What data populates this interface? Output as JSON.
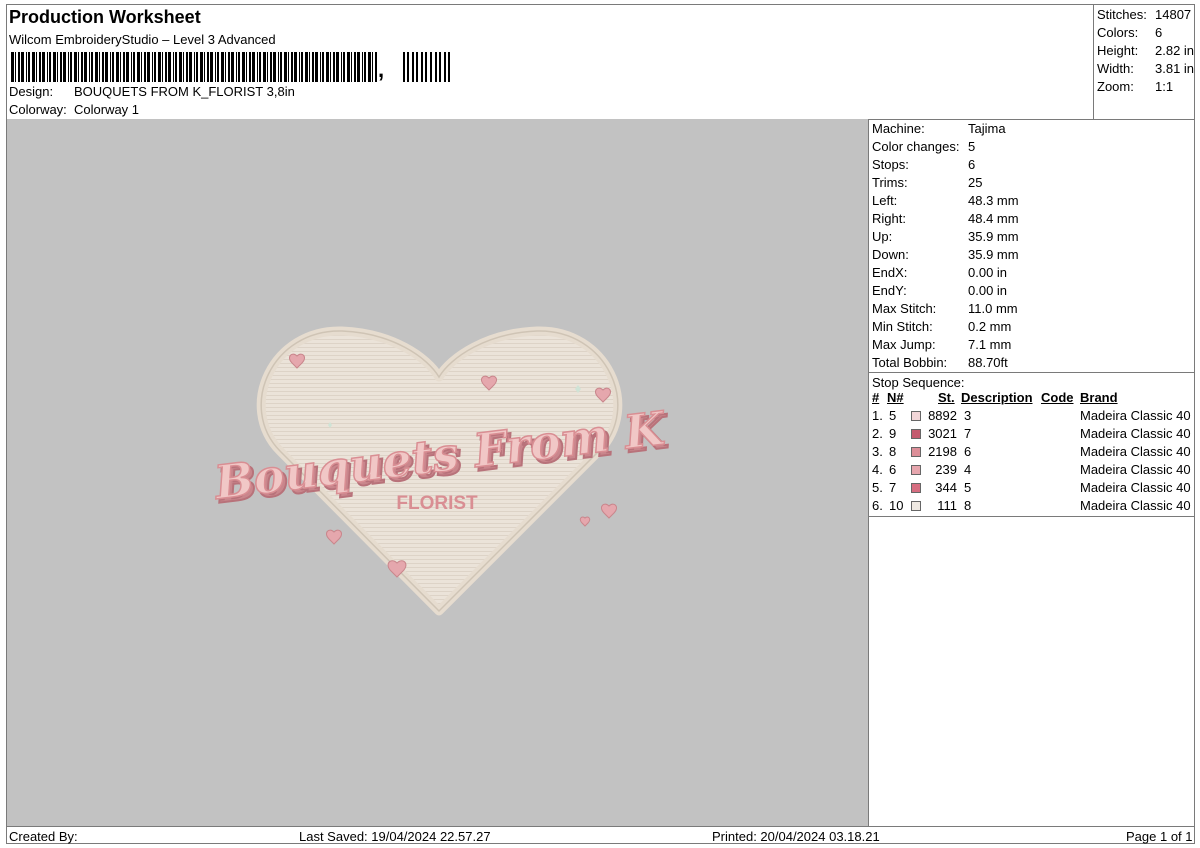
{
  "header": {
    "title": "Production Worksheet",
    "software": "Wilcom EmbroideryStudio – Level 3 Advanced",
    "barcode_suffix": ",",
    "design_label": "Design:",
    "design_value": "BOUQUETS FROM K_FLORIST 3,8in",
    "colorway_label": "Colorway:",
    "colorway_value": "Colorway 1"
  },
  "summary": [
    {
      "label": "Stitches:",
      "value": "14807"
    },
    {
      "label": "Colors:",
      "value": "6"
    },
    {
      "label": "Height:",
      "value": "2.82 in"
    },
    {
      "label": "Width:",
      "value": "3.81 in"
    },
    {
      "label": "Zoom:",
      "value": "1:1"
    }
  ],
  "machine_info": [
    {
      "label": "Machine:",
      "value": "Tajima"
    },
    {
      "label": "Color changes:",
      "value": "5"
    },
    {
      "label": "Stops:",
      "value": "6"
    },
    {
      "label": "Trims:",
      "value": "25"
    },
    {
      "label": "Left:",
      "value": "48.3 mm"
    },
    {
      "label": "Right:",
      "value": "48.4 mm"
    },
    {
      "label": "Up:",
      "value": "35.9 mm"
    },
    {
      "label": "Down:",
      "value": "35.9 mm"
    },
    {
      "label": "EndX:",
      "value": "0.00 in"
    },
    {
      "label": "EndY:",
      "value": "0.00 in"
    },
    {
      "label": "Max Stitch:",
      "value": "11.0 mm"
    },
    {
      "label": "Min Stitch:",
      "value": "0.2 mm"
    },
    {
      "label": "Max Jump:",
      "value": "7.1 mm"
    },
    {
      "label": "Total Bobbin:",
      "value": "88.70ft"
    }
  ],
  "stop_sequence": {
    "title": "Stop Sequence:",
    "columns": {
      "num": "#",
      "n": "N#",
      "st": "St.",
      "description": "Description",
      "code": "Code",
      "brand": "Brand"
    },
    "rows": [
      {
        "num": "1.",
        "n": "5",
        "color": "#f2d6d8",
        "st": "8892",
        "description": "3",
        "code": "",
        "brand": "Madeira Classic 40"
      },
      {
        "num": "2.",
        "n": "9",
        "color": "#c45a6e",
        "st": "3021",
        "description": "7",
        "code": "",
        "brand": "Madeira Classic 40"
      },
      {
        "num": "3.",
        "n": "8",
        "color": "#dd8f99",
        "st": "2198",
        "description": "6",
        "code": "",
        "brand": "Madeira Classic 40"
      },
      {
        "num": "4.",
        "n": "6",
        "color": "#e7a6ae",
        "st": "239",
        "description": "4",
        "code": "",
        "brand": "Madeira Classic 40"
      },
      {
        "num": "5.",
        "n": "7",
        "color": "#d66d80",
        "st": "344",
        "description": "5",
        "code": "",
        "brand": "Madeira Classic 40"
      },
      {
        "num": "6.",
        "n": "10",
        "color": "#efe9e2",
        "st": "111",
        "description": "8",
        "code": "",
        "brand": "Madeira Classic 40"
      }
    ]
  },
  "design_preview": {
    "line1": "Bouquets From K",
    "line2": "FLORIST",
    "fill_color": "#ebe3d9",
    "text_color": "#d98e93"
  },
  "footer": {
    "created_by": "Created By:",
    "last_saved": "Last Saved: 19/04/2024 22.57.27",
    "printed": "Printed: 20/04/2024 03.18.21",
    "page": "Page 1 of 1"
  }
}
